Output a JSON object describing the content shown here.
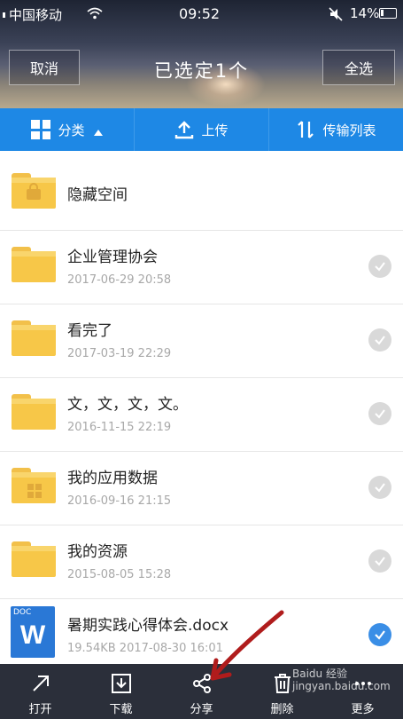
{
  "status": {
    "carrier": "中国移动",
    "time": "09:52",
    "battery": "14%"
  },
  "header": {
    "cancel_label": "取消",
    "title": "已选定1个",
    "select_all_label": "全选"
  },
  "toolbar": {
    "category_label": "分类",
    "upload_label": "上传",
    "transfer_label": "传输列表"
  },
  "items": [
    {
      "name": "隐藏空间",
      "date": "",
      "checked": false,
      "icon": "lock-folder-icon"
    },
    {
      "name": "企业管理协会",
      "date": "2017-06-29  20:58",
      "checked": false,
      "icon": "folder-icon"
    },
    {
      "name": "看完了",
      "date": "2017-03-19  22:29",
      "checked": false,
      "icon": "folder-icon"
    },
    {
      "name": "文，文，文，文。",
      "date": "2016-11-15  22:19",
      "checked": false,
      "icon": "folder-icon"
    },
    {
      "name": "我的应用数据",
      "date": "2016-09-16  21:15",
      "checked": false,
      "icon": "app-folder-icon"
    },
    {
      "name": "我的资源",
      "date": "2015-08-05  15:28",
      "checked": false,
      "icon": "folder-icon"
    },
    {
      "name": "暑期实践心得体会.docx",
      "date": "19.54KB  2017-08-30  16:01",
      "checked": true,
      "icon": "docx-icon",
      "doc_label": "DOC",
      "doc_letter": "W"
    }
  ],
  "bottom": {
    "open": "打开",
    "download": "下载",
    "share": "分享",
    "delete": "删除",
    "more": "更多"
  },
  "watermark": {
    "line1": "Baidu 经验",
    "line2": "jingyan.baidu.com"
  },
  "colors": {
    "accent": "#1e88e5",
    "folder": "#f7c748",
    "check_on": "#3a8ee6",
    "bottom_bar": "#2b2f3a",
    "annotation_arrow": "#b01c1c"
  }
}
